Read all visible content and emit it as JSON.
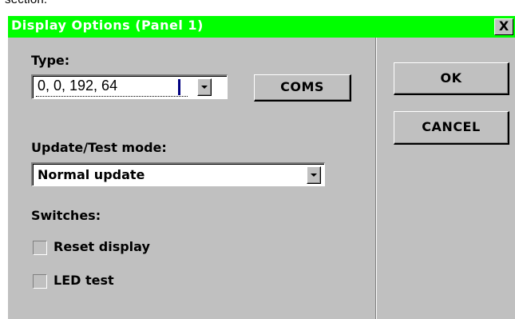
{
  "above_dialog_text": "section.",
  "window": {
    "title": "Display Options (Panel 1)",
    "close_label": "X"
  },
  "type_section": {
    "label": "Type:",
    "value": "0, 0, 192, 64",
    "coms_label": "COMS"
  },
  "update_section": {
    "label": "Update/Test mode:",
    "value": "Normal update"
  },
  "switches": {
    "label": "Switches:",
    "items": [
      {
        "label": "Reset display",
        "checked": false
      },
      {
        "label": "LED test",
        "checked": false
      }
    ]
  },
  "actions": {
    "ok_label": "OK",
    "cancel_label": "CANCEL"
  },
  "colors": {
    "titlebar": "#00ff00",
    "face": "#c0c0c0"
  },
  "icons": {
    "dropdown": "chevron-down-icon",
    "close": "close-icon"
  }
}
